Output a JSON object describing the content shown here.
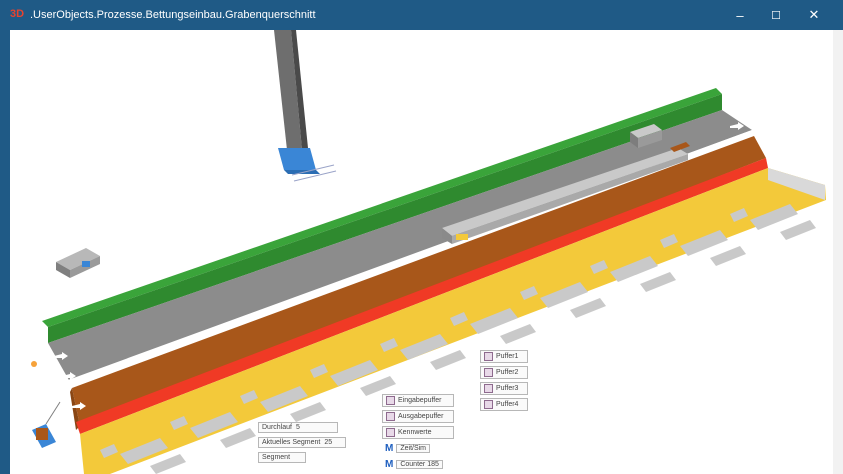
{
  "window": {
    "app_icon_text": "3D",
    "title": ".UserObjects.Prozesse.Bettungseinbau.Grabenquerschnitt",
    "minimize_glyph": "–",
    "maximize_glyph": "☐",
    "close_glyph": "✕"
  },
  "scene": {
    "colors": {
      "background": "#ffffff",
      "green_wall": "#3aa43a",
      "road": "#8c8c8c",
      "brown_layer": "#a8571a",
      "red_stripe": "#f03a25",
      "bedding_yellow": "#f3c93a",
      "bedding_gray": "#c9c9c9",
      "machine_blue": "#3a86d6"
    },
    "panel_left": {
      "items": [
        {
          "label": "Durchlauf",
          "value": "5"
        },
        {
          "label": "Aktuelles Segment",
          "value": "25"
        },
        {
          "label": "Segment",
          "value": ""
        }
      ]
    },
    "panel_center": {
      "items": [
        {
          "icon": "box",
          "label": "Eingabepuffer"
        },
        {
          "icon": "box",
          "label": "Ausgabepuffer"
        },
        {
          "icon": "box",
          "label": "Kennwerte"
        },
        {
          "icon": "M",
          "label": "Zeit/Sim"
        },
        {
          "icon": "M",
          "label": "Counter",
          "value": "185"
        }
      ]
    },
    "panel_right": {
      "items": [
        {
          "label": "Puffer1"
        },
        {
          "label": "Puffer2"
        },
        {
          "label": "Puffer3"
        },
        {
          "label": "Puffer4"
        }
      ]
    }
  }
}
